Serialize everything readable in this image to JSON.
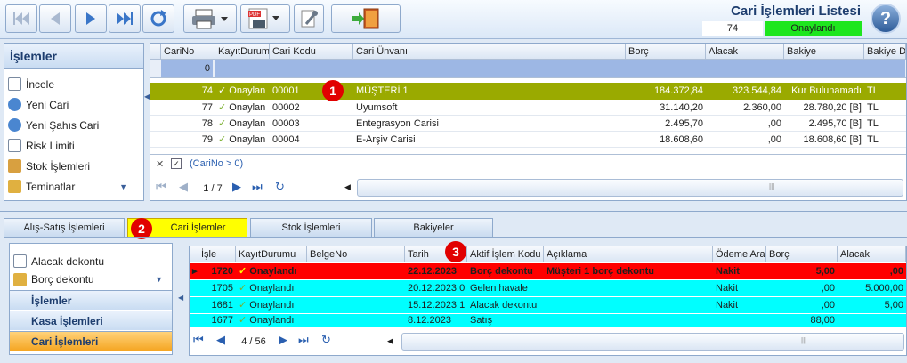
{
  "header": {
    "title": "Cari İşlemleri Listesi",
    "count": "74",
    "status": "Onaylandı",
    "help": "?"
  },
  "left_panel": {
    "title": "İşlemler",
    "items": [
      {
        "label": "İncele",
        "icon": "document-icon"
      },
      {
        "label": "Yeni Cari",
        "icon": "add-icon"
      },
      {
        "label": "Yeni Şahıs Cari",
        "icon": "add-person-icon"
      },
      {
        "label": "Risk Limiti",
        "icon": "list-icon"
      },
      {
        "label": "Stok İşlemleri",
        "icon": "stock-icon"
      },
      {
        "label": "Teminatlar",
        "icon": "folder-icon"
      }
    ]
  },
  "grid1": {
    "columns": [
      "CariNo",
      "KayıtDurumu",
      "Cari Kodu",
      "Cari Ünvanı",
      "Borç",
      "Alacak",
      "Bakiye",
      "Bakiye D"
    ],
    "filter_value": "0",
    "filter_text": "(CariNo > 0)",
    "page": "1 / 7",
    "rows": [
      {
        "no": "74",
        "status": "Onaylan",
        "code": "00001",
        "name": "MÜŞTERİ 1",
        "borc": "184.372,84",
        "alacak": "323.544,84",
        "bakiye": "Kur Bulunamadı",
        "doviz": "TL"
      },
      {
        "no": "77",
        "status": "Onaylan",
        "code": "00002",
        "name": "Uyumsoft",
        "borc": "31.140,20",
        "alacak": "2.360,00",
        "bakiye": "28.780,20 [B]",
        "doviz": "TL"
      },
      {
        "no": "78",
        "status": "Onaylan",
        "code": "00003",
        "name": "Entegrasyon Carisi",
        "borc": "2.495,70",
        "alacak": ",00",
        "bakiye": "2.495,70 [B]",
        "doviz": "TL"
      },
      {
        "no": "79",
        "status": "Onaylan",
        "code": "00004",
        "name": "E-Arşiv Carisi",
        "borc": "18.608,60",
        "alacak": ",00",
        "bakiye": "18.608,60 [B]",
        "doviz": "TL"
      }
    ]
  },
  "tabs": [
    "Alış-Satış İşlemleri",
    "Cari İşlemler",
    "Stok İşlemleri",
    "Bakiyeler"
  ],
  "lower_left": {
    "items": [
      {
        "label": "Alacak dekontu"
      },
      {
        "label": "Borç dekontu"
      }
    ],
    "sections": [
      "İşlemler",
      "Kasa İşlemleri",
      "Cari İşlemleri"
    ]
  },
  "grid2": {
    "columns": [
      "İşle",
      "KayıtDurumu",
      "BelgeNo",
      "Tarih",
      "Aktif İşlem Kodu",
      "Açıklama",
      "Ödeme Ara",
      "Borç",
      "Alacak"
    ],
    "page": "4 / 56",
    "rows": [
      {
        "no": "1720",
        "status": "Onaylandı",
        "belge": "",
        "tarih": "22.12.2023",
        "kod": "Borç dekontu",
        "aciklama": "Müşteri 1 borç dekontu",
        "odeme": "Nakit",
        "borc": "5,00",
        "alacak": ",00"
      },
      {
        "no": "1705",
        "status": "Onaylandı",
        "belge": "",
        "tarih": "20.12.2023 0",
        "kod": "Gelen havale",
        "aciklama": "",
        "odeme": "Nakit",
        "borc": ",00",
        "alacak": "5.000,00"
      },
      {
        "no": "1681",
        "status": "Onaylandı",
        "belge": "",
        "tarih": "15.12.2023 1",
        "kod": "Alacak dekontu",
        "aciklama": "",
        "odeme": "Nakit",
        "borc": ",00",
        "alacak": "5,00"
      },
      {
        "no": "1677",
        "status": "Onaylandı",
        "belge": "",
        "tarih": "8.12.2023",
        "kod": "Satış",
        "aciklama": "",
        "odeme": "",
        "borc": "88,00",
        "alacak": ""
      }
    ]
  },
  "badges": [
    "1",
    "2",
    "3"
  ],
  "colors": {
    "selected_row": "#9aaa00",
    "red_row": "#ff0000",
    "cyan_row": "#00ffff",
    "status_green": "#1ee61e",
    "active_tab": "#ffff00"
  }
}
